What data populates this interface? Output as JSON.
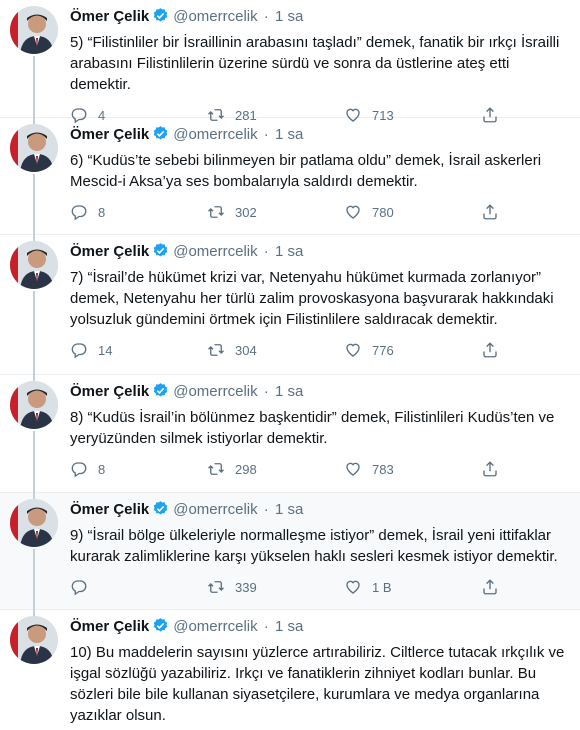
{
  "author": {
    "name": "Ömer Çelik",
    "handle": "@omerrcelik",
    "dot": "·"
  },
  "colors": {
    "accent": "#1da1f2",
    "muted": "#5b7083",
    "text": "#0f1419",
    "highlight_bg": "#f7f9fa"
  },
  "icons": {
    "reply": "reply-icon",
    "retweet": "retweet-icon",
    "like": "like-icon",
    "share": "share-icon",
    "verified": "verified-badge-icon"
  },
  "tweets": [
    {
      "time": "1 sa",
      "text": "5) “Filistinliler bir İsraillinin arabasını taşladı” demek, fanatik bir ırkçı İsrailli arabasını Filistinlilerin üzerine sürdü ve sonra da üstlerine ateş etti demektir.",
      "replies": "4",
      "retweets": "281",
      "likes": "713"
    },
    {
      "time": "1 sa",
      "text": "6) “Kudüs’te sebebi bilinmeyen bir patlama oldu” demek, İsrail askerleri Mescid-i Aksa’ya ses bombalarıyla saldırdı demektir.",
      "replies": "8",
      "retweets": "302",
      "likes": "780"
    },
    {
      "time": "1 sa",
      "text": "7) “İsrail’de hükümet krizi var, Netenyahu hükümet kurmada zorlanıyor” demek, Netenyahu her türlü zalim provoskasyona başvurarak hakkındaki yolsuzluk gündemini örtmek için Filistinlilere saldıracak demektir.",
      "replies": "14",
      "retweets": "304",
      "likes": "776"
    },
    {
      "time": "1 sa",
      "text": "8) “Kudüs İsrail’in bölünmez başkentidir” demek, Filistinlileri Kudüs’ten ve yeryüzünden silmek istiyorlar demektir.",
      "replies": "8",
      "retweets": "298",
      "likes": "783"
    },
    {
      "time": "1 sa",
      "text": "9) “İsrail bölge ülkeleriyle normalleşme istiyor” demek, İsrail yeni ittifaklar kurarak zalimliklerine karşı yükselen haklı sesleri kesmek istiyor demektir.",
      "replies": "",
      "retweets": "339",
      "likes": "1 B"
    },
    {
      "time": "1 sa",
      "text": "10) Bu maddelerin sayısını yüzlerce artırabiliriz. Ciltlerce tutacak ırkçılık ve işgal sözlüğü yazabiliriz. Irkçı ve fanatiklerin zihniyet kodları bunlar. Bu sözleri bile bile kullanan siyasetçilere, kurumlara ve medya organlarına yazıklar olsun.",
      "replies": "",
      "retweets": "",
      "likes": ""
    }
  ]
}
